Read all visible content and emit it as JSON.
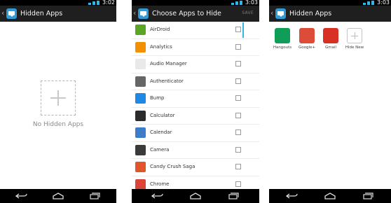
{
  "screens": [
    {
      "status_time": "3:02",
      "title": "Hidden Apps",
      "empty_text": "No Hidden Apps"
    },
    {
      "status_time": "3:03",
      "title": "Choose Apps to Hide",
      "save_label": "SAVE",
      "apps": [
        {
          "label": "AirDroid",
          "icon": "airdroid-icon",
          "color": "#5aa624",
          "checked": false
        },
        {
          "label": "Analytics",
          "icon": "analytics-icon",
          "color": "#f29000",
          "checked": false
        },
        {
          "label": "Audio Manager",
          "icon": "audio-manager-icon",
          "color": "#e9e9e9",
          "checked": false
        },
        {
          "label": "Authenticator",
          "icon": "authenticator-icon",
          "color": "#666666",
          "checked": false
        },
        {
          "label": "Bump",
          "icon": "bump-icon",
          "color": "#1e88e5",
          "checked": false
        },
        {
          "label": "Calculator",
          "icon": "calculator-icon",
          "color": "#2b2b2b",
          "checked": false
        },
        {
          "label": "Calendar",
          "icon": "calendar-icon",
          "color": "#3d7cc9",
          "checked": false
        },
        {
          "label": "Camera",
          "icon": "camera-icon",
          "color": "#3a3a3a",
          "checked": false
        },
        {
          "label": "Candy Crush Saga",
          "icon": "candy-crush-icon",
          "color": "#e0552a",
          "checked": false
        },
        {
          "label": "Chrome",
          "icon": "chrome-icon",
          "color": "#db4437",
          "checked": false
        }
      ]
    },
    {
      "status_time": "3:03",
      "title": "Hidden Apps",
      "apps": [
        {
          "label": "Hangouts",
          "icon": "hangouts-icon",
          "color": "#0f9d58"
        },
        {
          "label": "Google+",
          "icon": "google-plus-icon",
          "color": "#dd4b39"
        },
        {
          "label": "Gmail",
          "icon": "gmail-icon",
          "color": "#d93025"
        },
        {
          "label": "Hide New",
          "icon": "add-icon",
          "color": "#bdbdbd"
        }
      ]
    }
  ],
  "colors": {
    "action_bar": "#1f1f1f",
    "accent": "#33b5e5",
    "app_icon": "#2f9bd9"
  }
}
